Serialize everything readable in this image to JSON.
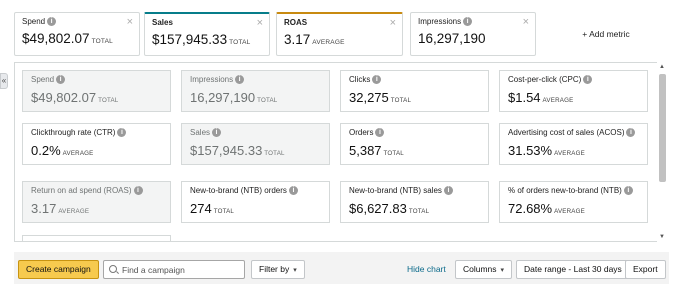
{
  "tabs": [
    {
      "label": "Spend",
      "value": "$49,802.07",
      "unit": "TOTAL"
    },
    {
      "label": "Sales",
      "value": "$157,945.33",
      "unit": "TOTAL"
    },
    {
      "label": "ROAS",
      "value": "3.17",
      "unit": "AVERAGE"
    },
    {
      "label": "Impressions",
      "value": "16,297,190",
      "unit": "TOTAL"
    }
  ],
  "add_metric": "+ Add metric",
  "collapse_icon": "«",
  "close_glyph": "×",
  "cards": [
    {
      "label": "Spend",
      "value": "$49,802.07",
      "unit": "TOTAL"
    },
    {
      "label": "Impressions",
      "value": "16,297,190",
      "unit": "TOTAL"
    },
    {
      "label": "Clicks",
      "value": "32,275",
      "unit": "TOTAL"
    },
    {
      "label": "Cost-per-click (CPC)",
      "value": "$1.54",
      "unit": "AVERAGE"
    },
    {
      "label": "Clickthrough rate (CTR)",
      "value": "0.2%",
      "unit": "AVERAGE"
    },
    {
      "label": "Sales",
      "value": "$157,945.33",
      "unit": "TOTAL"
    },
    {
      "label": "Orders",
      "value": "5,387",
      "unit": "TOTAL"
    },
    {
      "label": "Advertising cost of sales (ACOS)",
      "value": "31.53%",
      "unit": "AVERAGE"
    },
    {
      "label": "Return on ad spend (ROAS)",
      "value": "3.17",
      "unit": "AVERAGE"
    },
    {
      "label": "New-to-brand (NTB) orders",
      "value": "274",
      "unit": "TOTAL"
    },
    {
      "label": "New-to-brand (NTB) sales",
      "value": "$6,627.83",
      "unit": "TOTAL"
    },
    {
      "label": "% of orders new-to-brand (NTB)",
      "value": "72.68%",
      "unit": "AVERAGE"
    }
  ],
  "toolbar": {
    "create_campaign": "Create campaign",
    "search_placeholder": "Find a campaign",
    "filter_by": "Filter by",
    "hide_chart": "Hide chart",
    "columns": "Columns",
    "date_range": "Date range - Last 30 days",
    "export": "Export"
  }
}
